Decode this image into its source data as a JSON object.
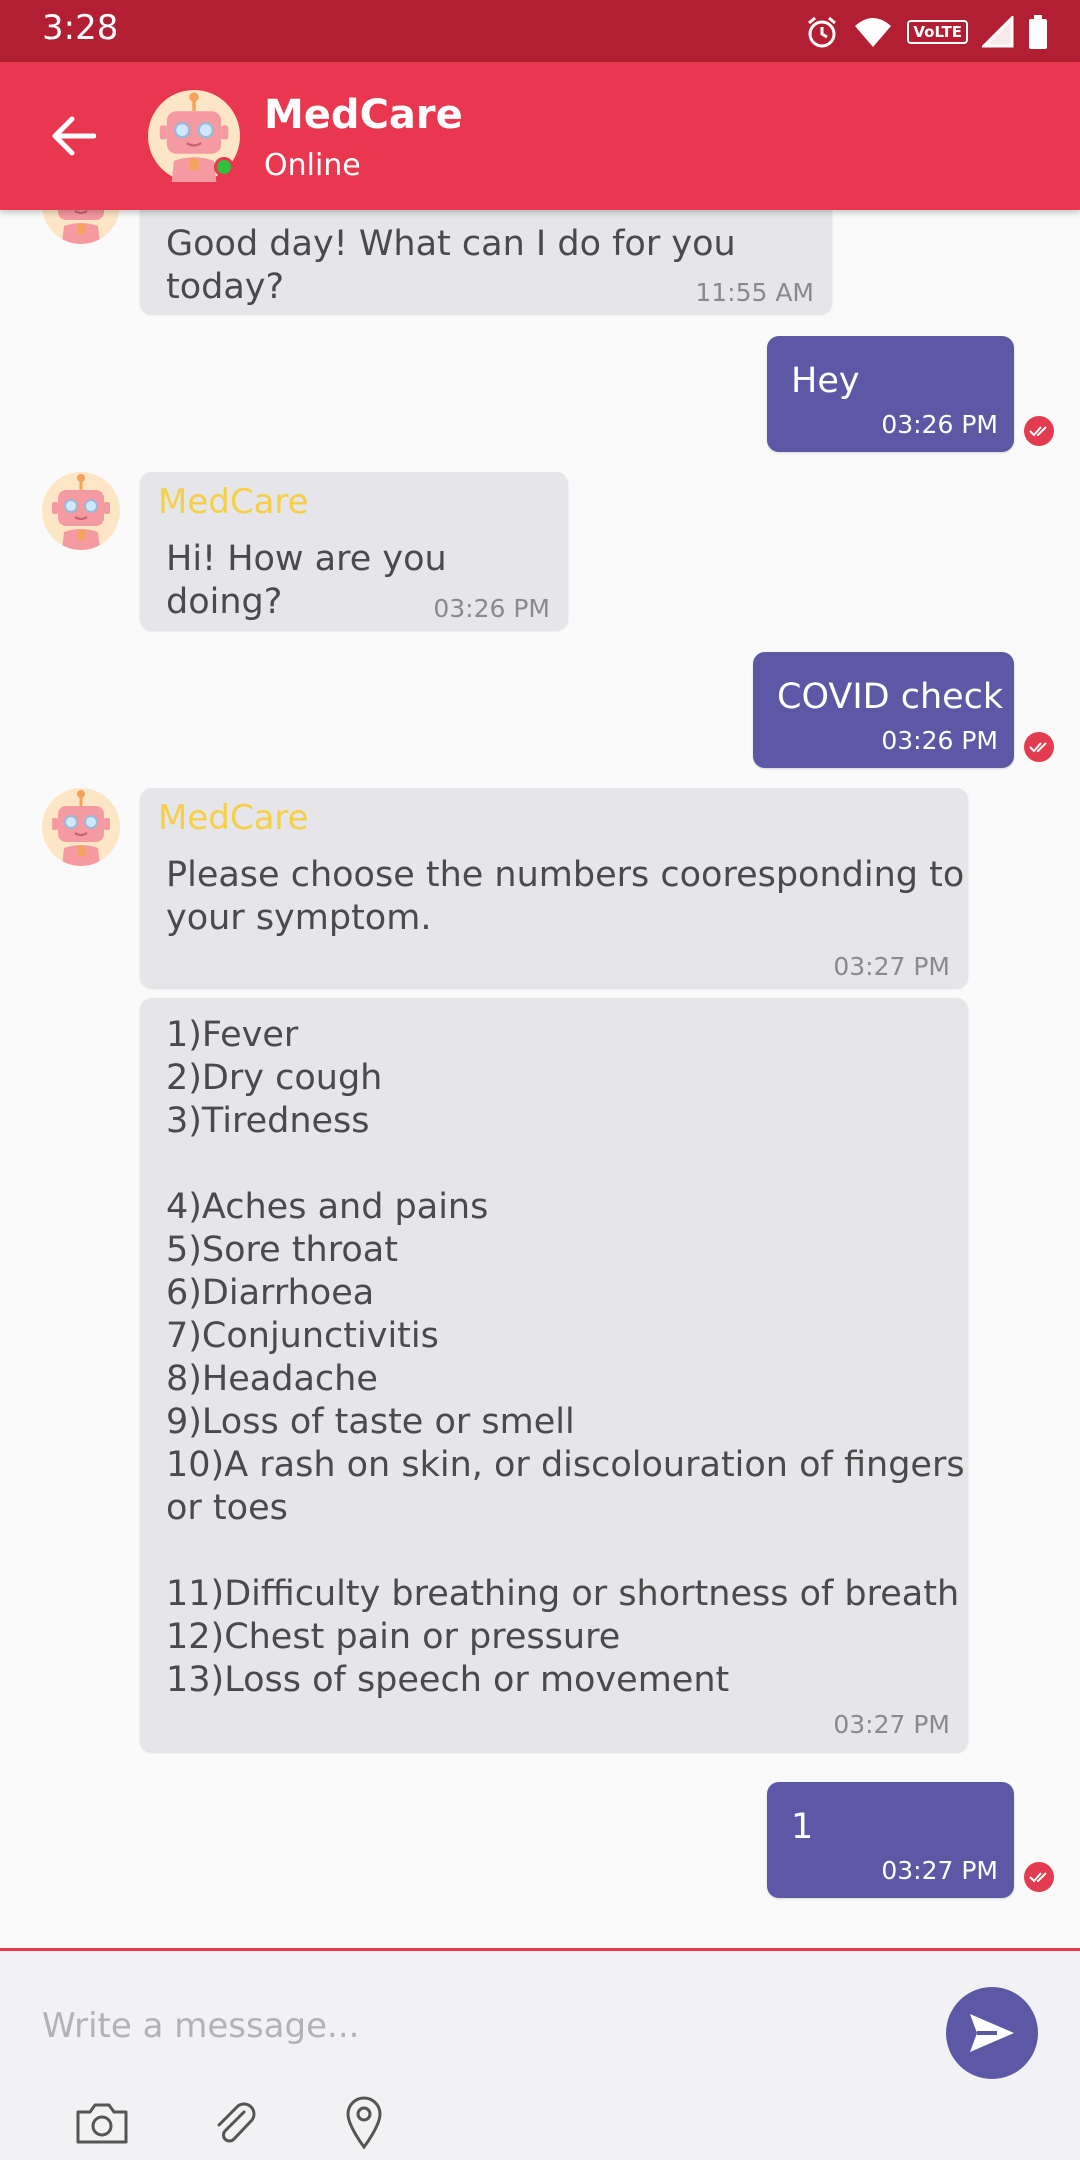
{
  "status_bar": {
    "time": "3:28",
    "volte": "VoLTE"
  },
  "header": {
    "name": "MedCare",
    "status": "Online"
  },
  "messages": [
    {
      "text": "Good day! What can I do for you today?",
      "time": "11:55 AM"
    },
    {
      "text": "Hey",
      "time": "03:26 PM"
    },
    {
      "sender": "MedCare",
      "text": "Hi! How are you doing?",
      "time": "03:26 PM"
    },
    {
      "text": "COVID check",
      "time": "03:26 PM"
    },
    {
      "sender": "MedCare",
      "text": "Please choose the numbers cooresponding to\nyour symptom.",
      "time": "03:27 PM"
    },
    {
      "text": "1)Fever\n2)Dry cough\n3)Tiredness\n\n4)Aches and pains\n5)Sore throat\n6)Diarrhoea\n7)Conjunctivitis\n8)Headache\n9)Loss of taste or smell\n10)A rash on skin, or discolouration of fingers\nor toes\n\n11)Difficulty breathing or shortness of breath\n12)Chest pain or pressure\n13)Loss of speech or movement",
      "time": "03:27 PM"
    },
    {
      "text": "1",
      "time": "03:27 PM"
    }
  ],
  "composer": {
    "placeholder": "Write a message..."
  },
  "icons": {
    "back": "arrow-left-icon",
    "send": "send-icon",
    "camera": "camera-icon",
    "attach": "paperclip-icon",
    "location": "location-pin-icon",
    "read": "double-check-icon"
  },
  "colors": {
    "status_bar": "#b21e32",
    "app_bar": "#e8374e",
    "outgoing_bubble": "#5c58a6",
    "incoming_bubble": "#e5e5ea",
    "sender_name": "#f5cf44",
    "online": "#2fbf3a"
  }
}
